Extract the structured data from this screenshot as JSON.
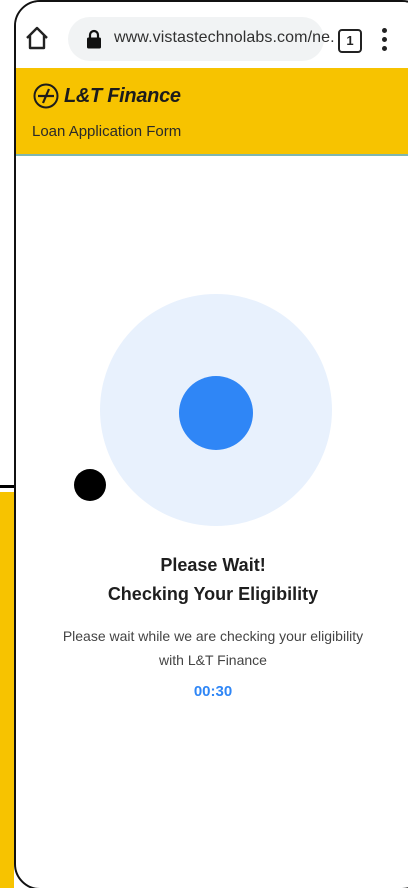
{
  "browser": {
    "url": "www.vistastechnolabs.com/ne.",
    "tab_count": "1",
    "icons": [
      "home-icon",
      "lock-icon",
      "tabs-icon",
      "more-vert-icon"
    ]
  },
  "header": {
    "brand": "L&T Finance",
    "subtitle": "Loan Application Form"
  },
  "status": {
    "title_line1": "Please Wait!",
    "title_line2": "Checking Your Eligibility",
    "description": "Please wait while we are checking your eligibility with L&T Finance",
    "timer": "00:30"
  },
  "colors": {
    "brand_yellow": "#F7C300",
    "accent_blue": "#2F86F6",
    "loader_bg": "#E8F1FD"
  }
}
